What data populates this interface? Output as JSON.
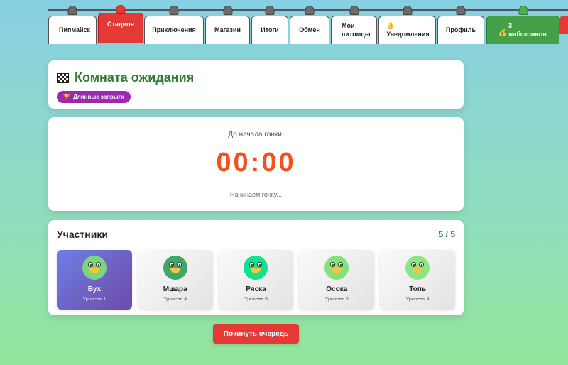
{
  "nav": {
    "tabs": [
      {
        "label": "Пипмайск"
      },
      {
        "label": "Стадион"
      },
      {
        "label": "Приключения"
      },
      {
        "label": "Магазин"
      },
      {
        "label": "Итоги"
      },
      {
        "label": "Обмен"
      },
      {
        "line1": "Мои",
        "line2": "питомцы"
      },
      {
        "icon": "🔔",
        "label": "Уведомления"
      },
      {
        "label": "Профиль"
      },
      {
        "icon": "💰",
        "line1": "3",
        "line2": "жабскоинов"
      }
    ]
  },
  "header": {
    "icon": "checkered-flag-icon",
    "title": "Комната ожидания",
    "mode_badge": {
      "icon": "🏆",
      "label": "Длинные запрыги"
    }
  },
  "timer": {
    "label": "До начала гонки:",
    "value": "00:00",
    "status": "Начинаем гонку..."
  },
  "participants": {
    "title": "Участники",
    "count": "5 / 5",
    "items": [
      {
        "name": "Бух",
        "level": "Уровень 1",
        "avatar_color": "#7ed37e"
      },
      {
        "name": "Мшара",
        "level": "Уровень 4",
        "avatar_color": "#3fa768"
      },
      {
        "name": "Ряска",
        "level": "Уровень 5",
        "avatar_color": "#12e08a"
      },
      {
        "name": "Осока",
        "level": "Уровень 5",
        "avatar_color": "#86e07c"
      },
      {
        "name": "Топь",
        "level": "Уровень 4",
        "avatar_color": "#8de686"
      }
    ]
  },
  "actions": {
    "leave_label": "Покинуть очередь"
  },
  "colors": {
    "accent_green": "#2e7d32",
    "active_tab": "#e53935",
    "timer": "#f4511e",
    "badge": "#9c27b0",
    "current_player_card": "#6c7fe6"
  }
}
